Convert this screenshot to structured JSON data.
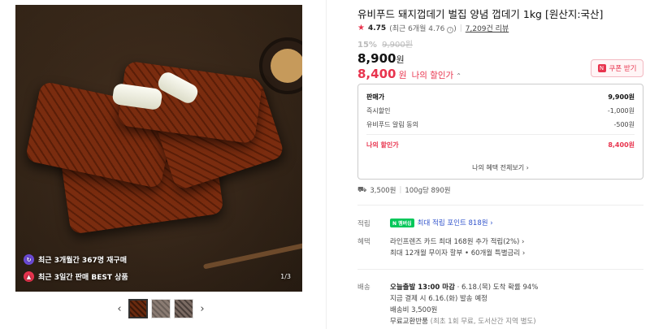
{
  "image": {
    "badge1": "최근 3개월간 367명 재구매",
    "badge2": "최근 3일간 판매 BEST 상품",
    "counter": "1/3",
    "prev_arrow": "‹",
    "next_arrow": "›"
  },
  "product": {
    "title": "유비푸드 돼지껍데기 벌집 양념 껍데기 1kg [원산지:국산]",
    "rating": "4.75",
    "rating_detail": "(최근 6개월 4.76",
    "rating_detail_close": ")",
    "reviews": "7,209건 리뷰",
    "discount_rate": "15%",
    "original_price": "9,900원",
    "price": "8,900",
    "price_unit": "원",
    "my_price": "8,400",
    "my_price_unit": "원",
    "my_price_label": "나의 할인가",
    "coupon_label": "쿠폰 받기",
    "coupon_icon_text": "N"
  },
  "price_box": {
    "sale_price_label": "판매가",
    "sale_price_value": "9,900원",
    "instant_discount_label": "즉시할인",
    "instant_discount_value": "-1,000원",
    "alarm_label": "유비푸드 알림 동의",
    "alarm_value": "-500원",
    "my_price_label": "나의 할인가",
    "my_price_value": "8,400원",
    "more_label": "나의 혜택 전체보기 ›"
  },
  "shipping_fee": {
    "fee": "3,500원",
    "per_unit": "100g당 890원"
  },
  "accumulation": {
    "label": "적립",
    "npay": "N 멤버십",
    "text": "최대 적립 포인트 818원 ›"
  },
  "benefits": {
    "label": "혜택",
    "line1": "라인프렌즈 카드 최대 168원 추가 적립(2%) ›",
    "line2": "최대 12개월 무이자 할부 • 60개월 특별금리 ›"
  },
  "delivery": {
    "label": "배송",
    "line1_bold": "오늘출발 13:00 마감",
    "line1_rest": " · 6.18.(목) 도착 확률 94%",
    "line2": "지금 결제 시 6.16.(화) 발송 예정",
    "line3": "배송비 3,500원",
    "line4_main": "무료교환반품",
    "line4_muted": " (최초 1회 무료, 도서산간 지역 별도)"
  },
  "colors": {
    "accent": "#e8344e",
    "link": "#3355cc",
    "npay": "#03c75a"
  }
}
